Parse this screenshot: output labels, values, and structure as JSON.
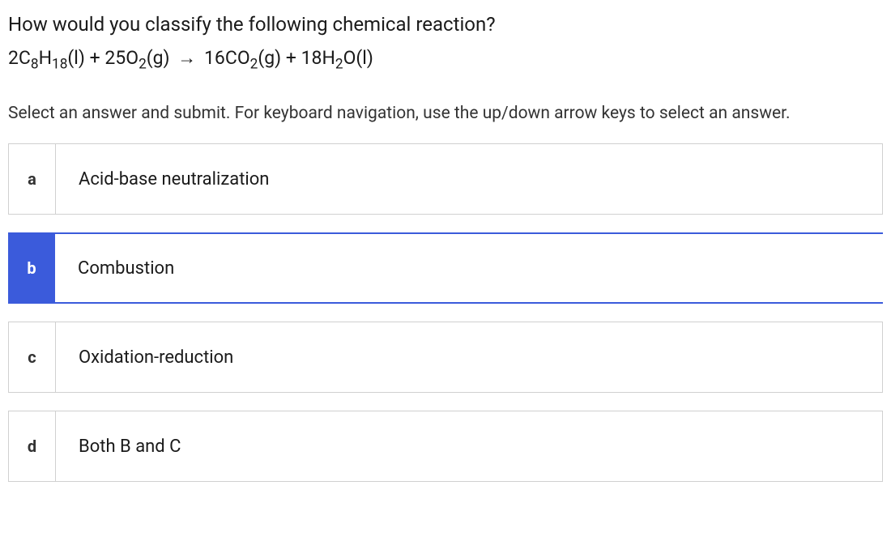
{
  "question": {
    "text": "How would you classify the following chemical reaction?",
    "equation_parts": {
      "left1_coef": "2C",
      "left1_sub1": "8",
      "left1_mid": "H",
      "left1_sub2": "18",
      "left1_state": "(l)",
      "plus1": " + ",
      "left2_coef": "25O",
      "left2_sub": "2",
      "left2_state": "(g)",
      "arrow": "→",
      "right1_coef": "16CO",
      "right1_sub": "2",
      "right1_state": "(g)",
      "plus2": " + ",
      "right2_coef": "18H",
      "right2_sub": "2",
      "right2_mid": "O",
      "right2_state": "(l)"
    }
  },
  "instructions": "Select an answer and submit. For keyboard navigation, use the up/down arrow keys to select an answer.",
  "answers": {
    "a": {
      "letter": "a",
      "text": "Acid-base neutralization",
      "selected": false
    },
    "b": {
      "letter": "b",
      "text": "Combustion",
      "selected": true
    },
    "c": {
      "letter": "c",
      "text": "Oxidation-reduction",
      "selected": false
    },
    "d": {
      "letter": "d",
      "text": "Both B and C",
      "selected": false
    }
  },
  "colors": {
    "accent": "#3b5bdb",
    "border": "#d0d0d0",
    "text": "#1a1a1a"
  }
}
